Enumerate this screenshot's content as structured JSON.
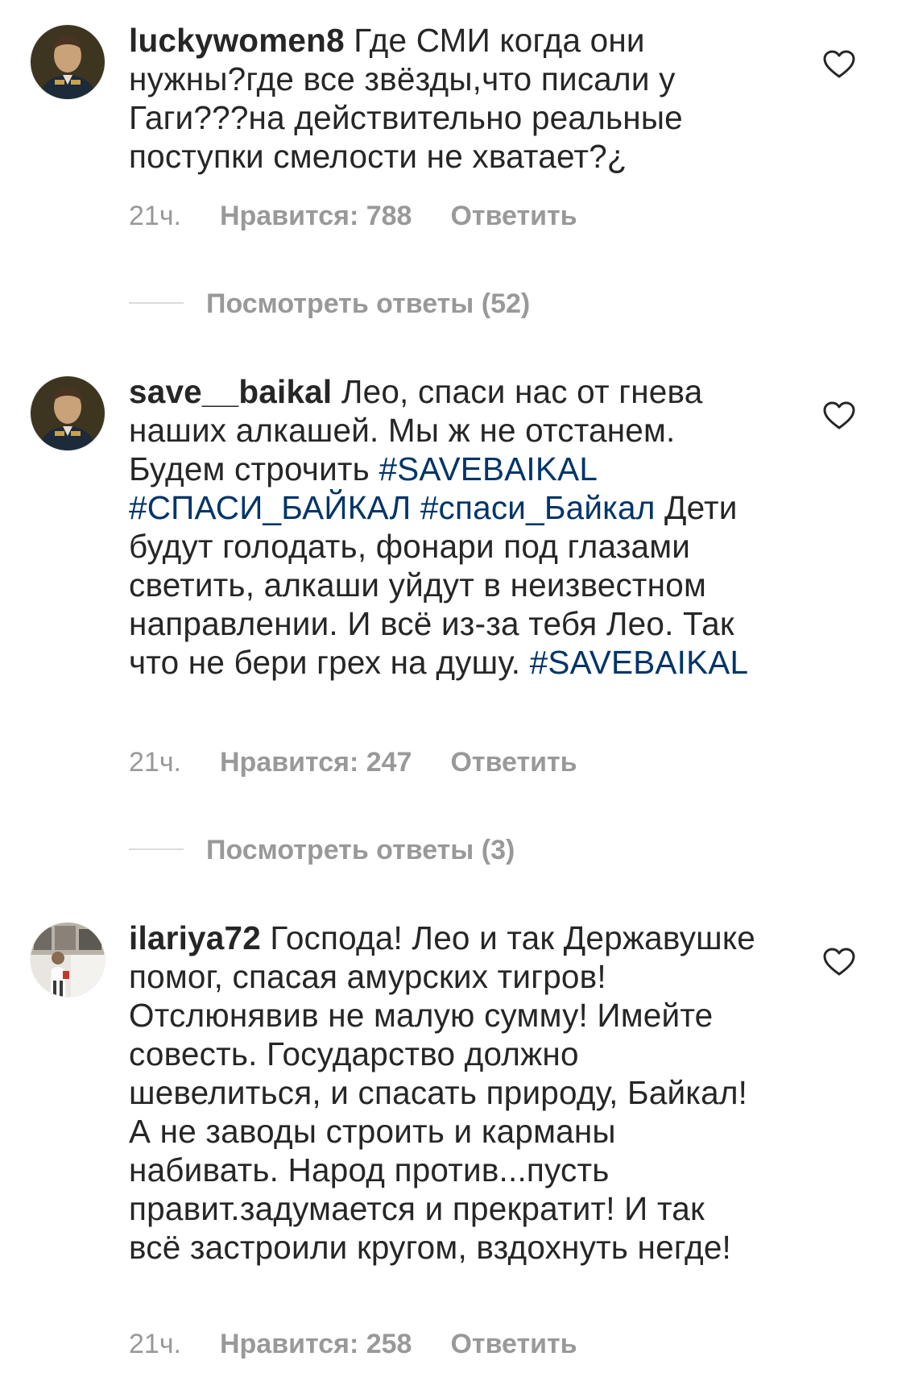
{
  "comments": [
    {
      "username": "luckywomen8",
      "text": " Где СМИ когда они нужны?где все звёзды,что писали у Гаги???на действительно реальные поступки смелости не хватает?¿",
      "time": "21ч.",
      "likes": "Нравится: 788",
      "reply": "Ответить",
      "view_replies": "Посмотреть ответы (52)",
      "avatar_icon": "portrait-avatar-icon"
    },
    {
      "username": "save__baikal",
      "text_parts": [
        " Лео, спаси нас от гнева наших алкашей. Мы ж не отстанем. Будем строчить ",
        "#SAVEBAIKAL",
        " ",
        "#СПАСИ_БАЙКАЛ",
        " ",
        "#спаси_Байкал",
        " Дети будут голодать, фонари под глазами светить, алкаши уйдут в неизвестном направлении. И всё из-за тебя Лео. Так что не бери грех на душу. ",
        "#SAVEBAIKAL"
      ],
      "time": "21ч.",
      "likes": "Нравится: 247",
      "reply": "Ответить",
      "view_replies": "Посмотреть ответы (3)",
      "avatar_icon": "portrait-avatar-icon"
    },
    {
      "username": "ilariya72",
      "text": " Господа! Лео и так Державушке помог, спасая амурских тигров! Отслюнявив не малую сумму! Имейте совесть. Государство должно шевелиться, и спасать природу, Байкал! А не заводы строить и карманы набивать. Народ против...пусть правит.задумается и прекратит! И так всё застроили кругом, вздохнуть негде!",
      "time": "21ч.",
      "likes": "Нравится: 258",
      "reply": "Ответить",
      "avatar_icon": "photo-avatar-icon"
    }
  ],
  "colors": {
    "text": "#262626",
    "muted": "#999999",
    "hashtag": "#003569",
    "divider": "#dbdbdb"
  },
  "icons": {
    "like": "heart-outline-icon"
  }
}
